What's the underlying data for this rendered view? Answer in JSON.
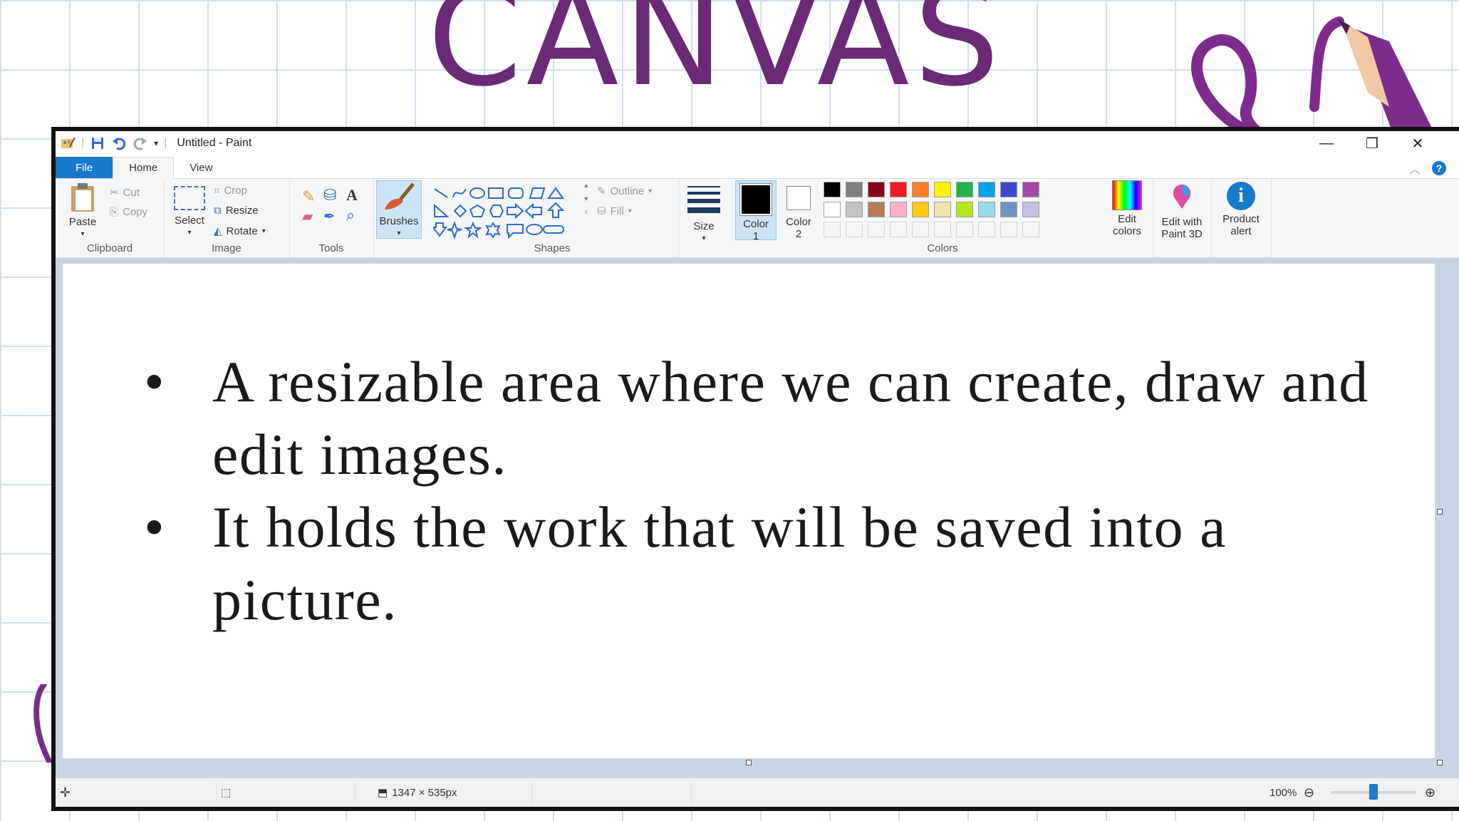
{
  "slide": {
    "title": "CANVAS"
  },
  "window": {
    "title": "Untitled - Paint"
  },
  "tabs": [
    {
      "label": "File"
    },
    {
      "label": "Home"
    },
    {
      "label": "View"
    }
  ],
  "ribbon": {
    "clipboard": {
      "paste": "Paste",
      "cut": "Cut",
      "copy": "Copy",
      "label": "Clipboard"
    },
    "image": {
      "select": "Select",
      "crop": "Crop",
      "resize": "Resize",
      "rotate": "Rotate",
      "label": "Image"
    },
    "tools": {
      "label": "Tools"
    },
    "brushes": {
      "label": "Brushes"
    },
    "shapes": {
      "outline": "Outline",
      "fill": "Fill",
      "label": "Shapes"
    },
    "size": {
      "label": "Size"
    },
    "colors": {
      "color1": "Color 1",
      "color1_line1": "Color",
      "color1_line2": "1",
      "color2_line1": "Color",
      "color2_line2": "2",
      "edit_line1": "Edit",
      "edit_line2": "colors",
      "label": "Colors",
      "color1_value": "#000000",
      "color2_value": "#ffffff",
      "palette_row1": [
        "#000000",
        "#7f7f7f",
        "#880015",
        "#ed1c24",
        "#ff7f27",
        "#fff200",
        "#22b14c",
        "#00a2e8",
        "#3f48cc",
        "#a349a4"
      ],
      "palette_row2": [
        "#ffffff",
        "#c3c3c3",
        "#b97a57",
        "#ffaec9",
        "#ffc90e",
        "#efe4b0",
        "#b5e61d",
        "#99d9ea",
        "#7092be",
        "#c8bfe7"
      ]
    },
    "paint3d": {
      "line1": "Edit with",
      "line2": "Paint 3D"
    },
    "product_alert": {
      "line1": "Product",
      "line2": "alert"
    }
  },
  "canvas": {
    "bullets": [
      "A resizable area where we can create, draw and edit images.",
      "It holds the work that will be saved into a picture."
    ]
  },
  "status": {
    "dimensions": "1347 × 535px",
    "zoom": "100%",
    "zoom_level": 0.5
  },
  "theme": {
    "accent": "#1979ca",
    "title_color": "#6a2a76"
  }
}
